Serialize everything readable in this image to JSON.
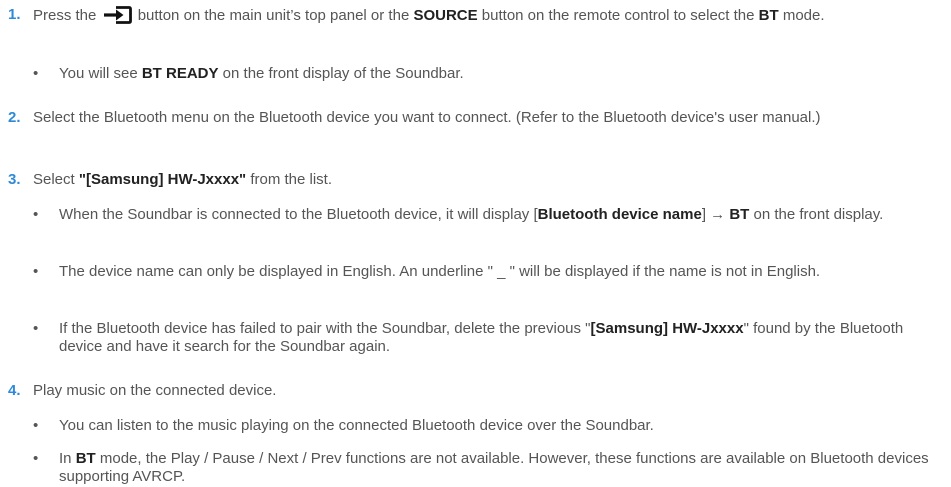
{
  "steps": [
    {
      "num": "1.",
      "a": "Press the ",
      "icon": "source-input-icon",
      "b": " button on the main unit’s top panel or the ",
      "c": "SOURCE",
      "d": " button on the remote control to select the ",
      "e": "BT",
      "f": " mode.",
      "bullets": [
        {
          "a": "You will see ",
          "b": "BT READY",
          "c": " on the front display of the Soundbar."
        }
      ]
    },
    {
      "num": "2.",
      "a": "Select the Bluetooth menu on the Bluetooth device you want to connect. (Refer to the Bluetooth device's user manual.)"
    },
    {
      "num": "3.",
      "a": "Select ",
      "b": "\"[Samsung] HW-Jxxxx\"",
      "c": " from the list.",
      "bullets": [
        {
          "a": "When the Soundbar is connected to the Bluetooth device, it will display [",
          "b": "Bluetooth device name",
          "c": "] → ",
          "d": "BT",
          "e": " on the front display."
        },
        {
          "a": "The device name can only be displayed in English. An underline \" _ \" will be displayed if the name is not in English."
        },
        {
          "a": "If the Bluetooth device has failed to pair with the Soundbar, delete the previous \"",
          "b": "[Samsung] HW-Jxxxx",
          "c": "\" found by the Bluetooth device and have it search for the Soundbar again."
        }
      ]
    },
    {
      "num": "4.",
      "a": "Play music on the connected device.",
      "bullets": [
        {
          "a": "You can listen to the music playing on the connected Bluetooth device over the Soundbar."
        },
        {
          "a": "In ",
          "b": "BT",
          "c": " mode, the Play / Pause / Next / Prev functions are not available. However, these functions are available on Bluetooth devices supporting AVRCP."
        }
      ]
    }
  ],
  "bullet_glyph": "•",
  "colors": {
    "step_number": "#2e8ad8",
    "body_text": "#555555",
    "bold_text": "#222222"
  }
}
